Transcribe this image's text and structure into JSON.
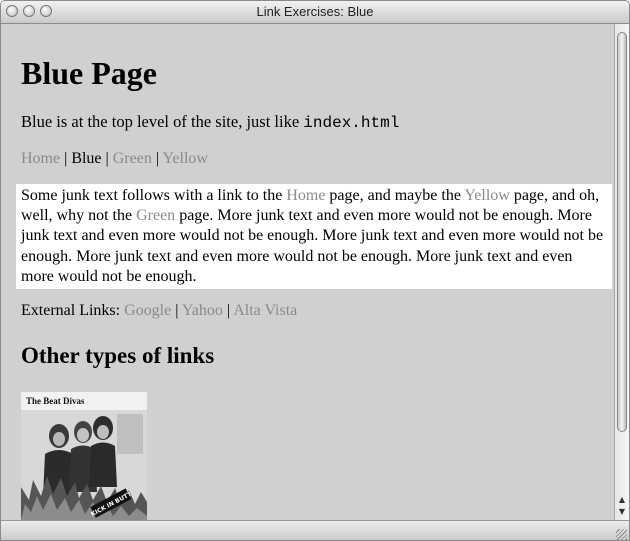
{
  "window": {
    "title": "Link Exercises: Blue"
  },
  "page": {
    "heading": "Blue Page",
    "intro_text": "Blue is at the top level of the site, just like ",
    "intro_code": "index.html",
    "nav": [
      {
        "label": "Home",
        "current": false
      },
      {
        "label": "Blue",
        "current": true
      },
      {
        "label": "Green",
        "current": false
      },
      {
        "label": "Yellow",
        "current": false
      }
    ],
    "nav_separator": " | ",
    "junk": {
      "t1": "Some junk text follows with a link to the ",
      "link1": "Home",
      "t2": " page, and maybe the ",
      "link2": "Yellow",
      "t3": " page, and oh, well, why not the ",
      "link3": "Green",
      "t4": " page. More junk text and even more would not be enough. More junk text and even more would not be enough. More junk text and even more would not be enough. More junk text and even more would not be enough. More junk text and even more would not be enough."
    },
    "external": {
      "label": "External Links: ",
      "links": [
        "Google",
        "Yahoo",
        "Alta Vista"
      ]
    },
    "subheading": "Other types of links",
    "album": {
      "title": "The Beat Divas",
      "sticker": "KICK IN BUTT"
    }
  },
  "colors": {
    "page_background": "#d0d0d0",
    "link": "#8a8a8a",
    "text": "#000000",
    "junk_background": "#ffffff"
  }
}
